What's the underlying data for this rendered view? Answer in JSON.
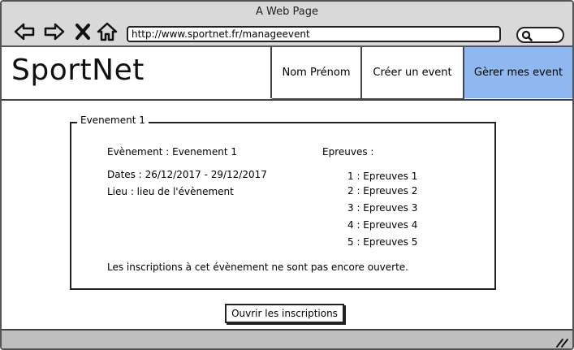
{
  "window": {
    "title": "A Web Page"
  },
  "browser": {
    "url": "http://www.sportnet.fr/manageevent"
  },
  "header": {
    "logo": "SportNet",
    "nav": [
      {
        "label": "Nom Prénom"
      },
      {
        "label": "Créer un event"
      },
      {
        "label": "Gèrer mes event"
      }
    ]
  },
  "event": {
    "legend": "Evenement 1",
    "name_line": "Evènement : Evenement 1",
    "dates_line": "Dates : 26/12/2017 - 29/12/2017",
    "place_line": "Lieu : lieu de l'évènement",
    "epreuves_title": "Epreuves :",
    "epreuves": [
      "1 : Epreuves 1",
      "2 : Epreuves 2",
      "3 : Epreuves 3",
      "4 : Epreuves 4",
      "5 : Epreuves 5"
    ],
    "status": "Les inscriptions à cet évènement ne sont pas encore ouverte."
  },
  "actions": {
    "open_registrations": "Ouvrir les inscriptions"
  },
  "colors": {
    "active_tab": "#8fb8f0",
    "chrome": "#d9d9d9",
    "footer": "#bfbfbf"
  }
}
